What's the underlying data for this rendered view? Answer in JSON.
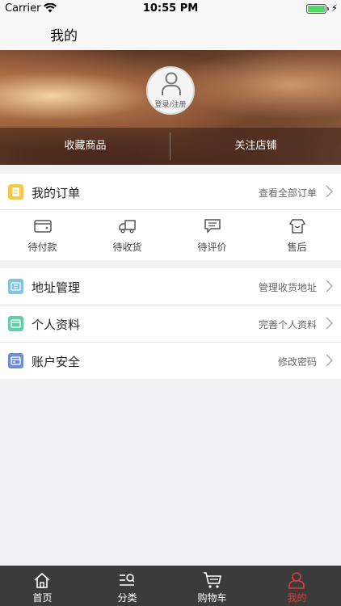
{
  "status_bar": {
    "carrier": "Carrier",
    "time": "10:55 PM"
  },
  "nav": {
    "title": "我的"
  },
  "profile": {
    "login_label": "登录/注册",
    "tabs": [
      "收藏商品",
      "关注店铺"
    ]
  },
  "orders": {
    "label": "我的订单",
    "hint": "查看全部订单",
    "actions": [
      "待付款",
      "待收货",
      "待评价",
      "售后"
    ]
  },
  "settings": [
    {
      "label": "地址管理",
      "hint": "管理收货地址",
      "icon": "address-icon",
      "color": "#7ec4e0"
    },
    {
      "label": "个人资料",
      "hint": "完善个人资料",
      "icon": "profile-card-icon",
      "color": "#5ecfa8"
    },
    {
      "label": "账户安全",
      "hint": "修改密码",
      "icon": "security-card-icon",
      "color": "#6a8fd6"
    }
  ],
  "tab_bar": {
    "items": [
      "首页",
      "分类",
      "购物车",
      "我的"
    ],
    "active_index": 3
  },
  "colors": {
    "accent": "#e03a3a",
    "order_icon": "#f5c84a"
  }
}
